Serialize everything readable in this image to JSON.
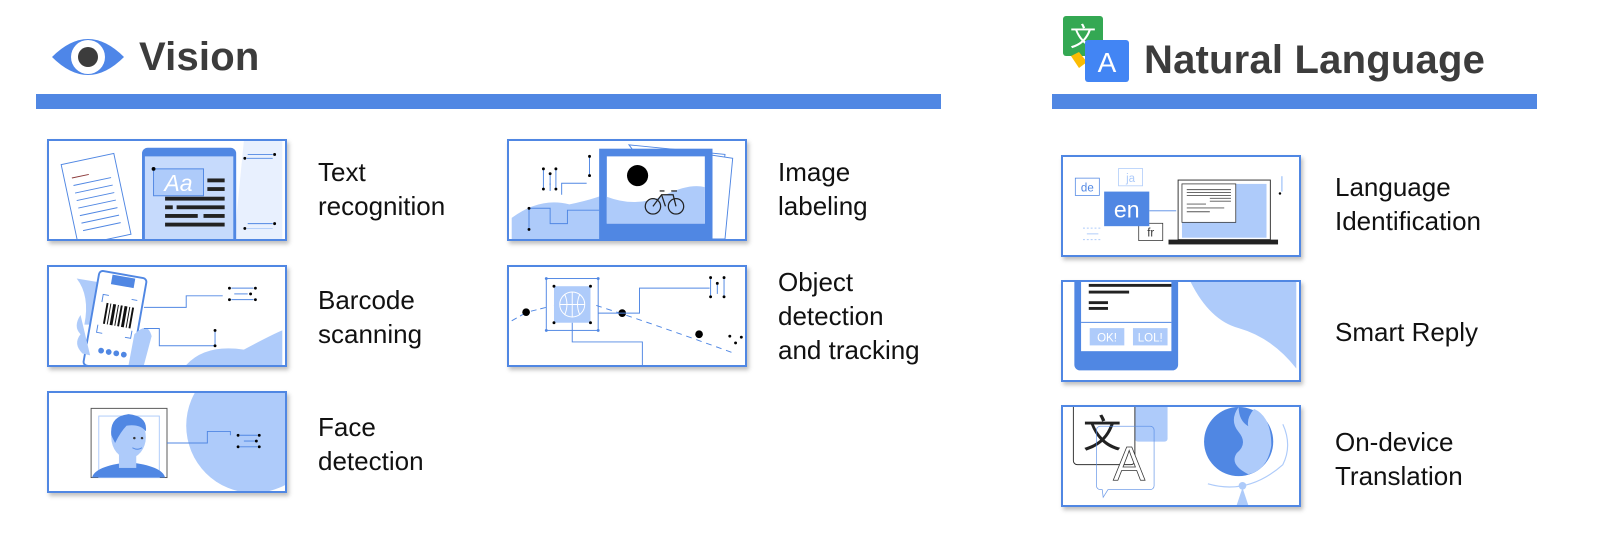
{
  "colors": {
    "accent": "#5087e3",
    "accent_light": "#aecbfa",
    "accent_pale": "#e8f0fe",
    "dark": "#222222",
    "google_green": "#34a853",
    "google_yellow": "#fbbc04",
    "google_blue": "#4285f4"
  },
  "sections": {
    "vision": {
      "title": "Vision",
      "icon": "eye-icon",
      "features": [
        {
          "label_line1": "Text",
          "label_line2": "recognition",
          "illustration": "text-recognition-illustration"
        },
        {
          "label_line1": "Barcode",
          "label_line2": "scanning",
          "illustration": "barcode-scanning-illustration"
        },
        {
          "label_line1": "Face",
          "label_line2": "detection",
          "illustration": "face-detection-illustration"
        },
        {
          "label_line1": "Image",
          "label_line2": "labeling",
          "illustration": "image-labeling-illustration"
        },
        {
          "label_line1": "Object",
          "label_line2": "detection",
          "label_line3": "and tracking",
          "illustration": "object-tracking-illustration"
        }
      ]
    },
    "natural_language": {
      "title": "Natural Language",
      "icon": "translate-icon",
      "icon_glyph_1": "文",
      "icon_glyph_2": "A",
      "features": [
        {
          "label_line1": "Language",
          "label_line2": "Identification",
          "illustration": "language-id-illustration",
          "tags": {
            "de": "de",
            "ja": "ja",
            "en": "en",
            "fr": "fr"
          }
        },
        {
          "label_line1": "Smart Reply",
          "illustration": "smart-reply-illustration",
          "chips": [
            "OK!",
            "LOL!"
          ]
        },
        {
          "label_line1": "On-device",
          "label_line2": "Translation",
          "illustration": "translation-illustration",
          "glyph_source": "文",
          "glyph_target": "A"
        }
      ]
    }
  }
}
